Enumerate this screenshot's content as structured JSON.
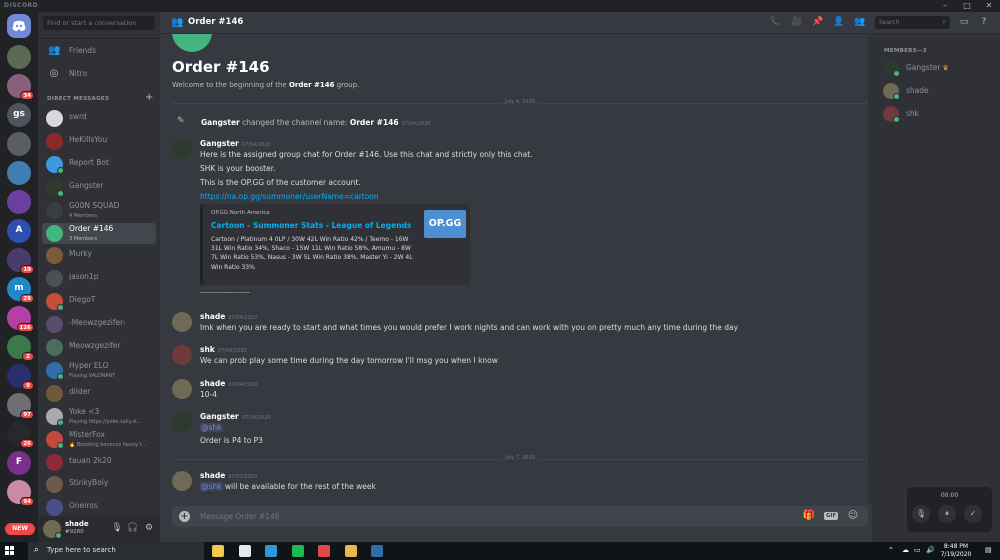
{
  "window": {
    "brand": "DISCORD"
  },
  "guilds": [
    {
      "label": "",
      "color": "#5a6b55",
      "badge": ""
    },
    {
      "label": "",
      "color": "#8a5f7a",
      "badge": "34"
    },
    {
      "label": "gs",
      "color": "#4f545c",
      "badge": ""
    },
    {
      "label": "",
      "color": "#5b5e63",
      "badge": ""
    },
    {
      "label": "",
      "color": "#3f7fb2",
      "badge": ""
    },
    {
      "label": "",
      "color": "#6b3fa0",
      "badge": ""
    },
    {
      "label": "A",
      "color": "#2f4fb0",
      "badge": ""
    },
    {
      "label": "",
      "color": "#4a3b6e",
      "badge": "19"
    },
    {
      "label": "m",
      "color": "#1e88c9",
      "badge": "29"
    },
    {
      "label": "",
      "color": "#b63fa6",
      "badge": "126"
    },
    {
      "label": "",
      "color": "#3a7a4a",
      "badge": "2"
    },
    {
      "label": "",
      "color": "#2a2d6e",
      "badge": "9"
    },
    {
      "label": "",
      "color": "#6e6e72",
      "badge": "97"
    },
    {
      "label": "",
      "color": "#26282c",
      "badge": "26"
    },
    {
      "label": "F",
      "color": "#7a2f8a",
      "badge": ""
    },
    {
      "label": "",
      "color": "#c98aa6",
      "badge": "94"
    }
  ],
  "new_badge": "NEW",
  "sidebar": {
    "search_placeholder": "Find or start a conversation",
    "nav": [
      {
        "label": "Friends",
        "icon": "👥"
      },
      {
        "label": "Nitro",
        "icon": "◎"
      }
    ],
    "dm_header": "DIRECT MESSAGES",
    "dm_add": "+",
    "dms": [
      {
        "name": "swrd",
        "sub": "",
        "color": "#d8d8dc",
        "online": false
      },
      {
        "name": "HeKillsYou",
        "sub": "",
        "color": "#8a2a2a",
        "online": false
      },
      {
        "name": "Report Bot",
        "sub": "",
        "color": "#3a9be0",
        "online": true
      },
      {
        "name": "Gangster",
        "sub": "",
        "color": "#2f3a2f",
        "online": true
      },
      {
        "name": "G00N SQUAD",
        "sub": "4 Members",
        "color": "#3a3d42",
        "online": false
      },
      {
        "name": "Order #146",
        "sub": "3 Members",
        "color": "#43b581",
        "online": false
      },
      {
        "name": "Murky",
        "sub": "",
        "color": "#7a5c3a",
        "online": false
      },
      {
        "name": "jason1p",
        "sub": "",
        "color": "#4c4f54",
        "online": false
      },
      {
        "name": "DiegoT",
        "sub": "",
        "color": "#c44e3a",
        "online": true
      },
      {
        "name": "-Meowzgezifer-",
        "sub": "",
        "color": "#5a4c6e",
        "online": false
      },
      {
        "name": "Meowzgezifer",
        "sub": "",
        "color": "#4a6e5c",
        "online": false
      },
      {
        "name": "Hyper ELO",
        "sub": "Playing VALORANT",
        "color": "#2f6ea8",
        "online": true
      },
      {
        "name": "dilder",
        "sub": "",
        "color": "#6e5a3a",
        "online": false
      },
      {
        "name": "Yoke <3",
        "sub": "Playing https://yoke.sally.st...",
        "color": "#a8a8ad",
        "online": true
      },
      {
        "name": "MisterFox",
        "sub": "🔥 Boosting bonecce heavy t...",
        "color": "#c4493a",
        "online": true
      },
      {
        "name": "tauan 2k20",
        "sub": "",
        "color": "#8a2a3a",
        "online": false
      },
      {
        "name": "StinkyBoiy",
        "sub": "",
        "color": "#6e5a4a",
        "online": false
      },
      {
        "name": "Oneiros",
        "sub": "",
        "color": "#4a4d8a",
        "online": false
      }
    ],
    "active_index": 5
  },
  "user": {
    "name": "shade",
    "tag": "#9280"
  },
  "topbar": {
    "title": "Order #146",
    "search_placeholder": "Search"
  },
  "chat": {
    "welcome_title": "Order #146",
    "welcome_prefix": "Welcome to the beginning of the ",
    "welcome_bold": "Order #146",
    "welcome_suffix": " group.",
    "date1": "July 4, 2020",
    "system": {
      "actor": "Gangster",
      "text": " changed the channel name: ",
      "new_name": "Order #146",
      "time": "07/04/2020"
    },
    "msg1": {
      "author": "Gangster",
      "time": "07/04/2020",
      "lines": [
        "Here is the assigned group chat for Order #146. Use this chat and strictly only this chat.",
        "SHK is your booster.",
        "This is the OP.GG of the customer account."
      ],
      "link": "https://na.op.gg/summoner/userName=cartoon",
      "embed": {
        "provider": "OP.GG North America",
        "title": "Cartoon - Summoner Stats - League of Legends",
        "description": "Cartoon / Platinum 4 0LP / 30W 42L Win Ratio 42% / Teemo - 16W 31L Win Ratio 34%, Shaco - 15W 11L Win Ratio 58%, Amumu - 8W 7L Win Ratio 53%, Nasus - 3W 5L Win Ratio 38%, Master Yi - 2W 4L Win Ratio 33%",
        "thumb": "OP.GG"
      },
      "separator": "-----------------------"
    },
    "msg2": {
      "author": "shade",
      "time": "07/04/2020",
      "text": "lmk when you are ready to start and what times you would prefer I work nights and can work with you on pretty much any time during the day"
    },
    "msg3": {
      "author": "shk",
      "time": "07/04/2020",
      "text": "We can prob play some time during the day tomorrow I'll msg you when I know"
    },
    "msg4": {
      "author": "shade",
      "time": "07/04/2020",
      "text": "10-4"
    },
    "msg5": {
      "author": "Gangster",
      "time": "07/04/2020",
      "mention": "@shk",
      "text": "Order is P4 to P3"
    },
    "date2": "July 7, 2020",
    "msg6": {
      "author": "shade",
      "time": "07/07/2020",
      "mention": "@shk",
      "text": " will be available for the rest of the week"
    }
  },
  "composer": {
    "placeholder": "Message Order #146",
    "gif": "GIF"
  },
  "members": {
    "header": "MEMBERS—3",
    "list": [
      {
        "name": "Gangster",
        "color": "#2f3a2f",
        "owner": true
      },
      {
        "name": "shade",
        "color": "#6f6a56",
        "owner": false
      },
      {
        "name": "shk",
        "color": "#6e3a3a",
        "owner": false
      }
    ]
  },
  "call": {
    "time": "00:00"
  },
  "taskbar": {
    "search_placeholder": "Type here to search",
    "time": "8:48 PM",
    "date": "7/19/2020",
    "apps": [
      "#f2c94c",
      "#e8e8e8",
      "#2d9ad8",
      "#1db954",
      "#e04a4a",
      "#e8b84a",
      "#2f6ea8"
    ]
  },
  "colors": {
    "accent": "#7289da",
    "online": "#43b581",
    "link": "#00b0f4",
    "danger": "#f04747"
  }
}
